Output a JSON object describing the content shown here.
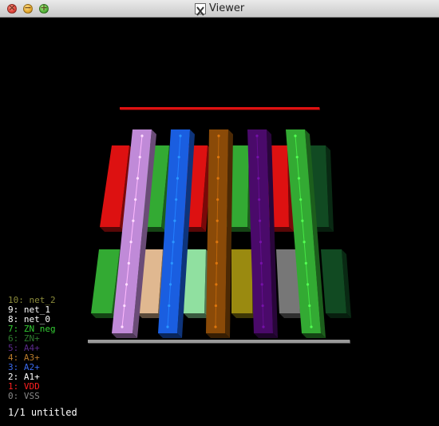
{
  "window": {
    "title": "Viewer",
    "buttons": {
      "close": "×",
      "minimize": "−",
      "maximize": "+"
    }
  },
  "legend": [
    {
      "text": "10: net_2",
      "color": "#8a8a3a"
    },
    {
      "text": "9: net_1",
      "color": "#ffffff"
    },
    {
      "text": "8: net_0",
      "color": "#ffffff"
    },
    {
      "text": "7: ZN_neg",
      "color": "#33cc33"
    },
    {
      "text": "6: ZN+",
      "color": "#2f7a2f"
    },
    {
      "text": "5: A4+",
      "color": "#5a2a8a"
    },
    {
      "text": "4: A3+",
      "color": "#b87a2a"
    },
    {
      "text": "3: A2+",
      "color": "#3a6aee"
    },
    {
      "text": "2: A1+",
      "color": "#ffffff"
    },
    {
      "text": "1: VDD",
      "color": "#ff2020"
    },
    {
      "text": "0: VSS",
      "color": "#8a8a8a"
    }
  ],
  "status": "1/1 untitled",
  "colors": {
    "vdd": "#dd1111",
    "vss": "#9a9a9a",
    "a1": "#c08ad8",
    "a2": "#1a5ee0",
    "a3": "#8a4a08",
    "a4": "#4a0a6a",
    "zn_pos": "#114a22",
    "zn_neg": "#33aa33",
    "net0": "#e0b890",
    "net1": "#90e0a0",
    "net2": "#9a8a10",
    "gray": "#777777"
  }
}
